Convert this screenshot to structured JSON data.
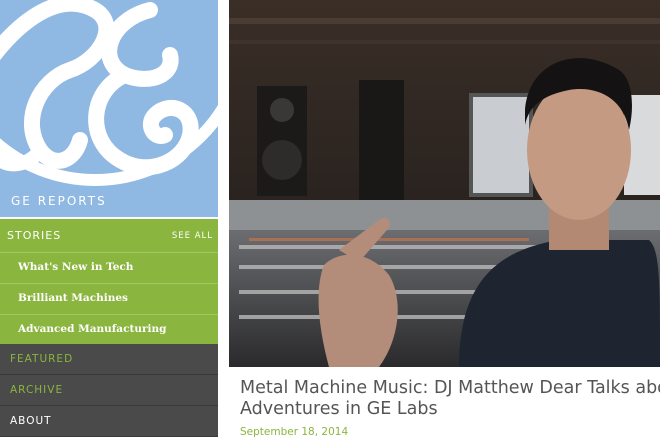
{
  "brand": {
    "logo_icon": "ge-monogram-logo",
    "name": "GE REPORTS",
    "color": "#8fb8e2"
  },
  "nav": {
    "stories": {
      "label": "STORIES",
      "see_all": "SEE ALL"
    },
    "sub_items": [
      {
        "label": "What's New in Tech"
      },
      {
        "label": "Brilliant Machines"
      },
      {
        "label": "Advanced Manufacturing"
      }
    ],
    "featured": "FEATURED",
    "archive": "ARCHIVE",
    "about": "ABOUT",
    "accent_color": "#8ab53f",
    "dark_color": "#4a4a4a"
  },
  "article": {
    "image_icon": "dj-studio-photo",
    "title_line1": "Metal Machine Music: DJ Matthew Dear Talks abo",
    "title_line2": "Adventures in GE Labs",
    "date": "September 18, 2014"
  }
}
